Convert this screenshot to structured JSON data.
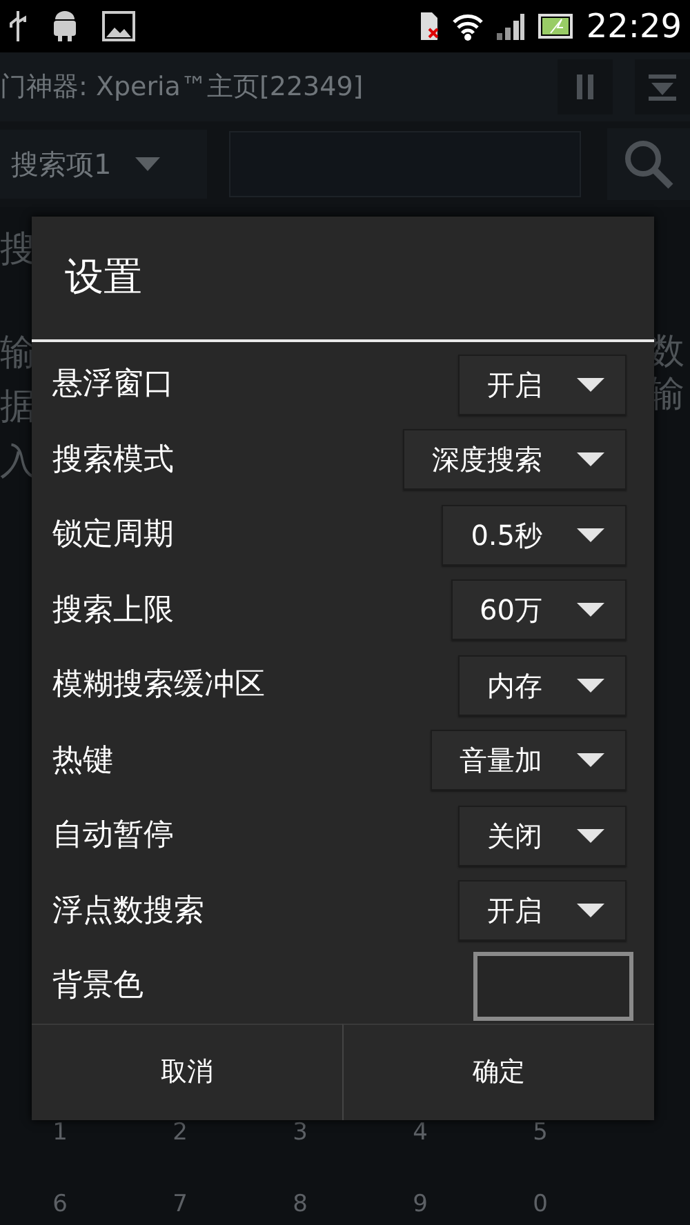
{
  "status_bar": {
    "time": "22:29"
  },
  "app_bar": {
    "title": "门神器: Xperia™主页[22349]"
  },
  "search_bar": {
    "spinner": "搜索项1"
  },
  "background": {
    "left_fragments": [
      "搜",
      "输",
      "据",
      "入"
    ],
    "right_fragments": [
      "数",
      "输"
    ],
    "key_rows": [
      [
        "1",
        "2",
        "3",
        "4",
        "5"
      ],
      [
        "6",
        "7",
        "8",
        "9",
        "0"
      ]
    ]
  },
  "dialog": {
    "title": "设置",
    "rows": [
      {
        "kind": "spinner",
        "label": "悬浮窗口",
        "value": "开启"
      },
      {
        "kind": "spinner",
        "label": "搜索模式",
        "value": "深度搜索"
      },
      {
        "kind": "spinner",
        "label": "锁定周期",
        "value": "0.5秒"
      },
      {
        "kind": "spinner",
        "label": "搜索上限",
        "value": "60万"
      },
      {
        "kind": "spinner",
        "label": "模糊搜索缓冲区",
        "value": "内存"
      },
      {
        "kind": "spinner",
        "label": "热键",
        "value": "音量加"
      },
      {
        "kind": "spinner",
        "label": "自动暂停",
        "value": "关闭"
      },
      {
        "kind": "spinner",
        "label": "浮点数搜索",
        "value": "开启"
      },
      {
        "kind": "color",
        "label": "背景色",
        "color": "#262626"
      }
    ],
    "buttons": [
      "取消",
      "确定"
    ]
  }
}
